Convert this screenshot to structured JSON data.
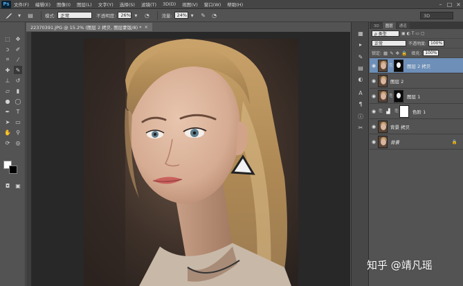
{
  "app": {
    "logo": "Ps"
  },
  "menu": [
    "文件(F)",
    "编辑(E)",
    "图像(I)",
    "图层(L)",
    "文字(Y)",
    "选择(S)",
    "滤镜(T)",
    "3D(D)",
    "视图(V)",
    "窗口(W)",
    "帮助(H)"
  ],
  "window_controls": [
    "–",
    "□",
    "×"
  ],
  "options": {
    "mode_label": "模式:",
    "mode_value": "正常",
    "opacity_label": "不透明度:",
    "opacity_value": "26%",
    "flow_label": "流量:",
    "flow_value": "24%",
    "workspace": "3D"
  },
  "document": {
    "tab_title": "22370391.JPG @ 15.2% (图层 2 拷贝, 图层蒙版/8) *",
    "close": "×"
  },
  "layers_panel": {
    "tabs": [
      "3D",
      "图层",
      "通道"
    ],
    "active_tab": "图层",
    "filter_label": "ρ 类型",
    "blend_mode": "正常",
    "opacity_label": "不透明度:",
    "opacity_value": "100%",
    "lock_label": "锁定:",
    "fill_label": "填充:",
    "fill_value": "100%",
    "layers": [
      {
        "name": "图层 2 拷贝",
        "selected": true,
        "mask": true,
        "italic": false,
        "locked": false
      },
      {
        "name": "图层 2",
        "selected": false,
        "mask": false,
        "italic": false,
        "locked": false
      },
      {
        "name": "图层 1",
        "selected": false,
        "mask": true,
        "italic": false,
        "locked": false
      },
      {
        "name": "色阶 1",
        "selected": false,
        "mask": true,
        "adjustment": true,
        "italic": false,
        "locked": false
      },
      {
        "name": "背景 拷贝",
        "selected": false,
        "mask": false,
        "italic": false,
        "locked": false
      },
      {
        "name": "背景",
        "selected": false,
        "mask": false,
        "italic": true,
        "locked": true
      }
    ]
  },
  "watermark": "知乎 @靖凡瑶"
}
